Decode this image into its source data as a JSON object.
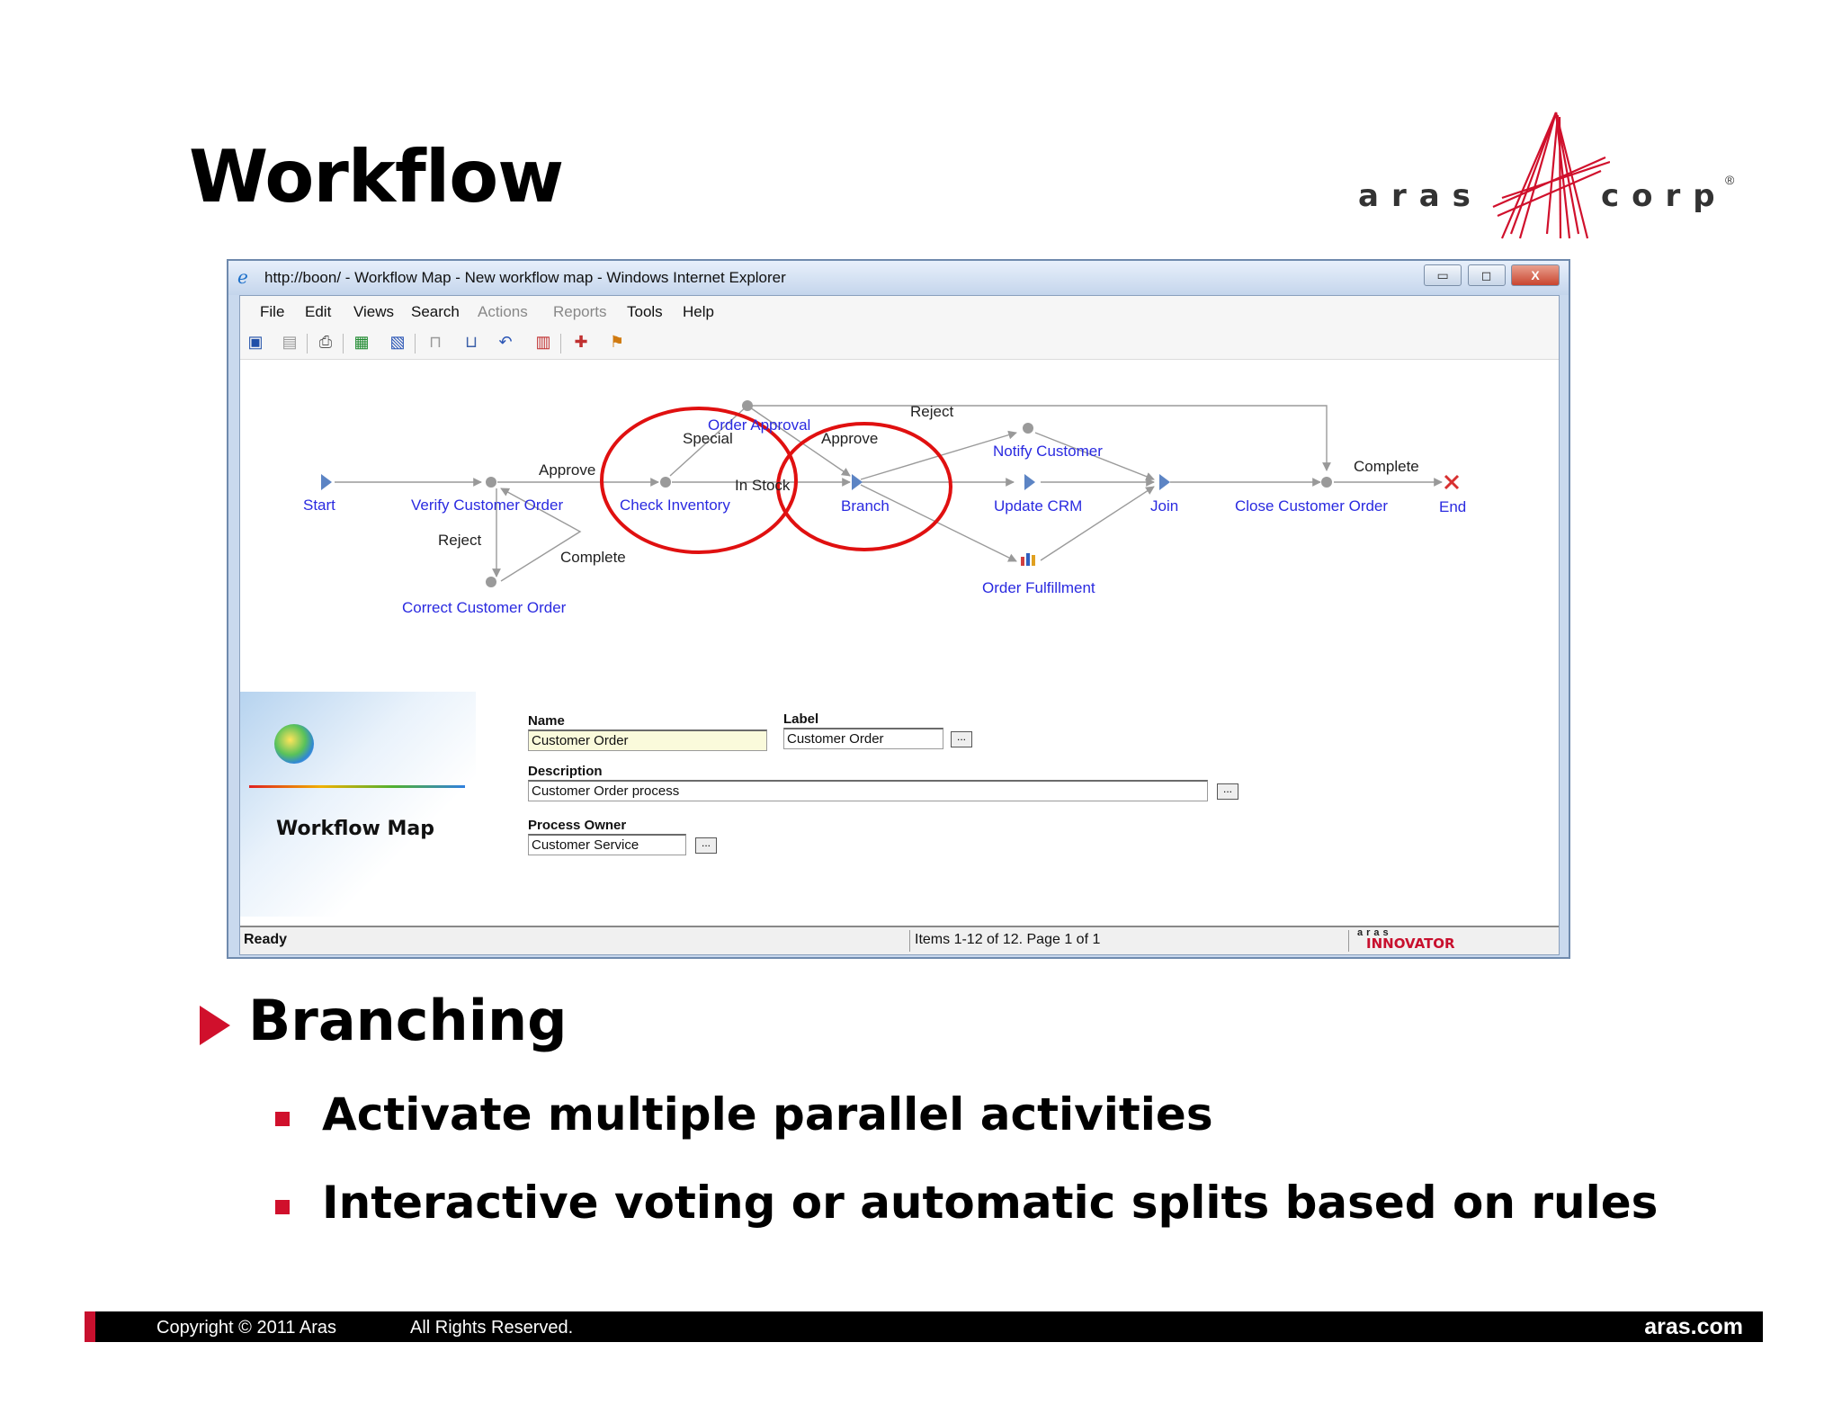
{
  "slide": {
    "title": "Workflow",
    "logo": {
      "left_word": "aras",
      "right_word": "corp",
      "registered": "®"
    },
    "bullets": {
      "main": "Branching",
      "sub": [
        "Activate multiple parallel activities",
        "Interactive voting or automatic splits based on rules"
      ]
    },
    "footer": {
      "copyright": "Copyright © 2011 Aras",
      "rights": "All Rights Reserved.",
      "site": "aras.com"
    }
  },
  "window": {
    "title": "http://boon/ - Workflow Map - New workflow map - Windows Internet Explorer",
    "controls": {
      "minimize": "▭",
      "restore": "◻",
      "close": "X"
    },
    "menu": [
      "File",
      "Edit",
      "Views",
      "Search",
      "Actions",
      "Reports",
      "Tools",
      "Help"
    ],
    "toolbar_icons": [
      "save-icon",
      "discard-icon",
      "print-icon",
      "excel-export-icon",
      "word-export-icon",
      "lock-icon",
      "unlock-icon",
      "undo-icon",
      "workflow-graph-icon",
      "claim-icon",
      "delegate-icon"
    ]
  },
  "workflow": {
    "nodes": {
      "start": "Start",
      "verify": "Verify Customer Order",
      "check_inventory": "Check Inventory",
      "order_approval": "Order Approval",
      "branch": "Branch",
      "notify_customer": "Notify Customer",
      "update_crm": "Update CRM",
      "order_fulfillment": "Order Fulfillment",
      "join": "Join",
      "close_order": "Close Customer Order",
      "end": "End",
      "correct_order": "Correct Customer Order"
    },
    "paths": {
      "approve_1": "Approve",
      "reject_1": "Reject",
      "complete_1": "Complete",
      "special": "Special",
      "in_stock": "In Stock",
      "approve_2": "Approve",
      "reject_2": "Reject",
      "complete_2": "Complete"
    },
    "highlight_color": "#e01010",
    "label_color": "#2a2ae0"
  },
  "properties": {
    "panel_title": "Workflow Map",
    "name_label": "Name",
    "name_value": "Customer Order",
    "label_label": "Label",
    "label_value": "Customer Order",
    "description_label": "Description",
    "description_value": "Customer Order process",
    "owner_label": "Process Owner",
    "owner_value": "Customer Service",
    "ellipsis": "..."
  },
  "status": {
    "ready": "Ready",
    "items": "Items 1-12 of 12. Page 1 of 1",
    "brand_top": "aras",
    "brand": "INNOVATOR"
  }
}
